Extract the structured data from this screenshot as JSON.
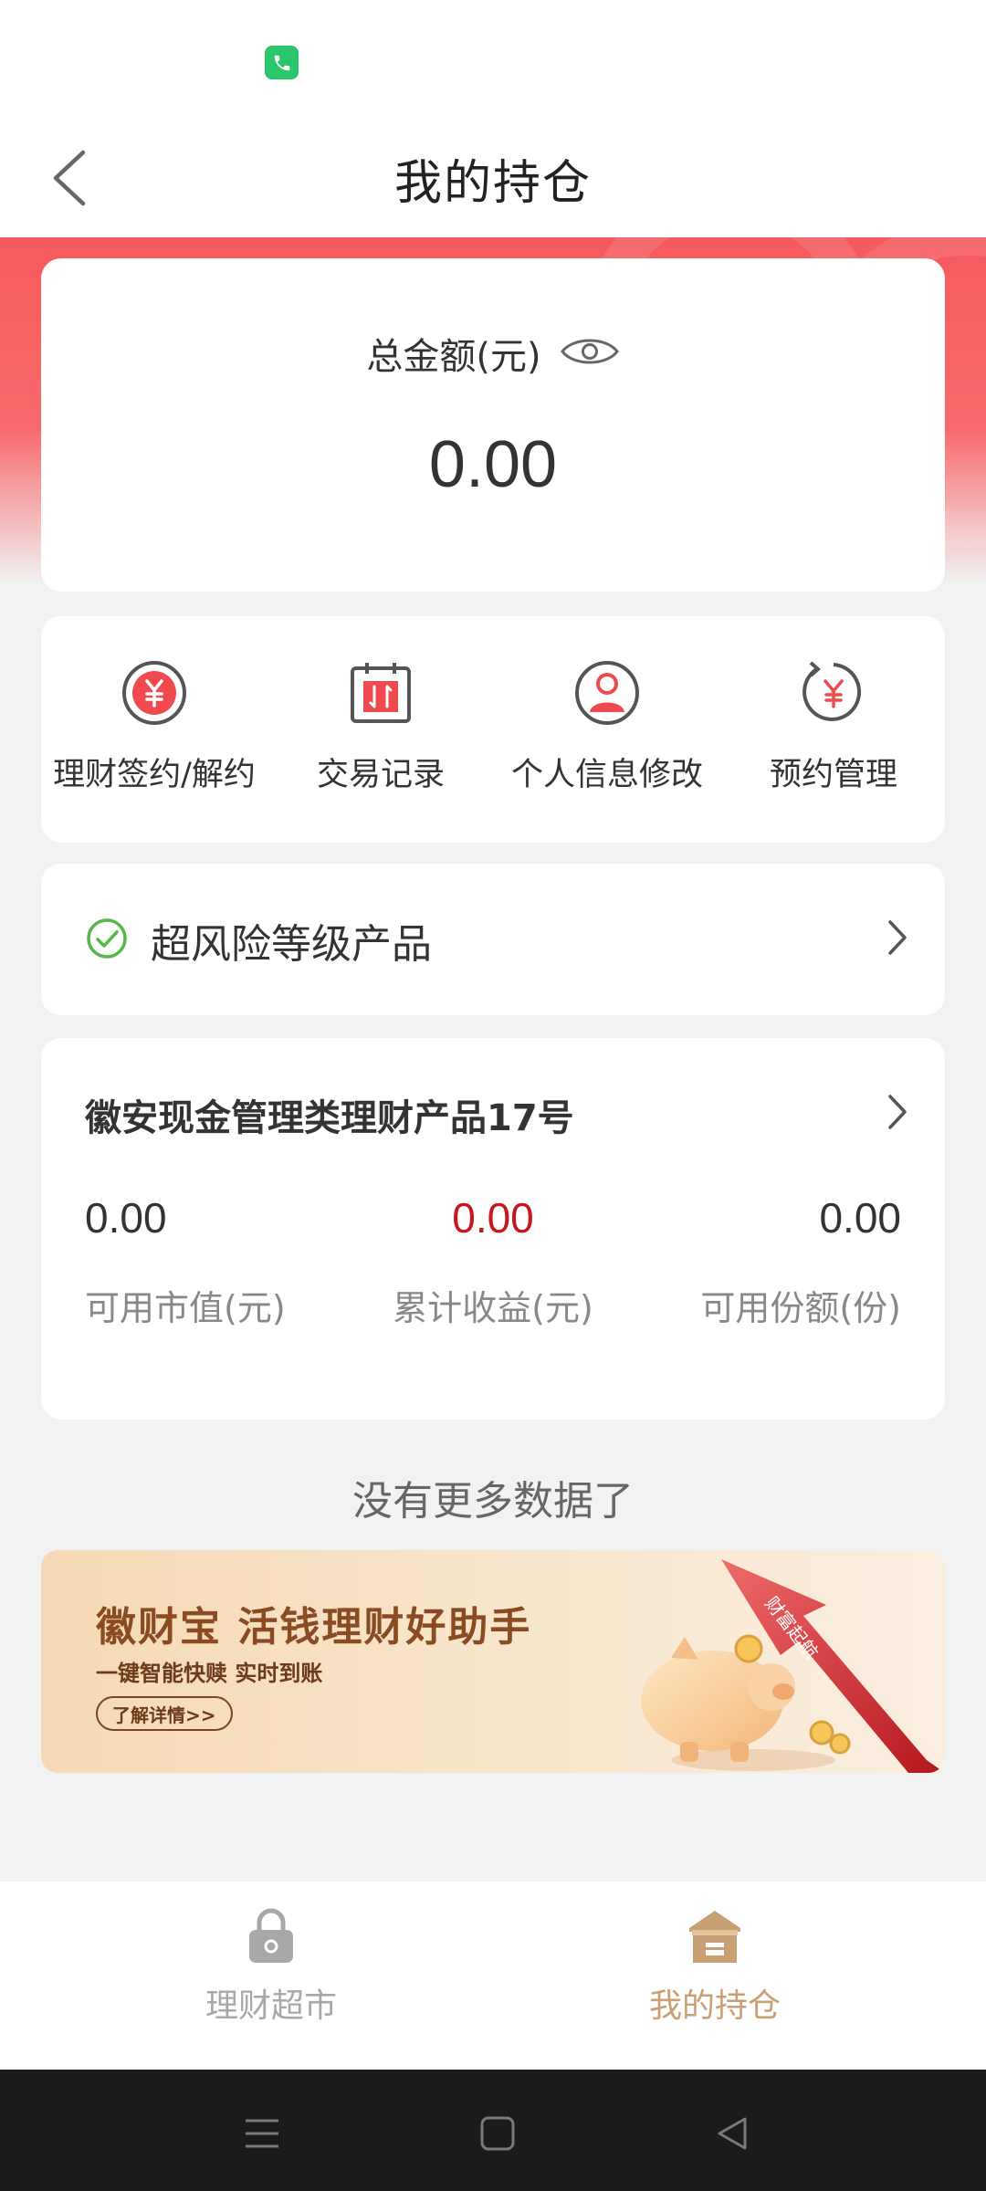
{
  "header": {
    "title": "我的持仓"
  },
  "summary": {
    "total_label": "总金额(元)",
    "total_value": "0.00"
  },
  "actions": [
    {
      "label": "理财签约/解约",
      "icon": "yuan-circle-icon"
    },
    {
      "label": "交易记录",
      "icon": "calendar-exchange-icon"
    },
    {
      "label": "个人信息修改",
      "icon": "person-circle-icon"
    },
    {
      "label": "预约管理",
      "icon": "yuan-refresh-icon"
    }
  ],
  "risk": {
    "label": "超风险等级产品"
  },
  "product": {
    "name": "徽安现金管理类理财产品17号",
    "metrics": [
      {
        "value": "0.00",
        "label": "可用市值(元)"
      },
      {
        "value": "0.00",
        "label": "累计收益(元)"
      },
      {
        "value": "0.00",
        "label": "可用份额(份)"
      }
    ]
  },
  "list_end_text": "没有更多数据了",
  "banner": {
    "title": "徽财宝 活钱理财好助手",
    "subtitle": "一键智能快赎 实时到账",
    "button": "了解详情>>",
    "art_text": "财富起航"
  },
  "tabs": [
    {
      "label": "理财超市",
      "icon": "lock-icon",
      "active": false
    },
    {
      "label": "我的持仓",
      "icon": "house-icon",
      "active": true
    }
  ],
  "colors": {
    "accent_red": "#f65a5d",
    "gain_red": "#c8161d",
    "icon_red": "#ef4b4f",
    "tab_active": "#c9a073",
    "tab_inactive": "#a8a8a8",
    "check_green": "#55b649"
  }
}
